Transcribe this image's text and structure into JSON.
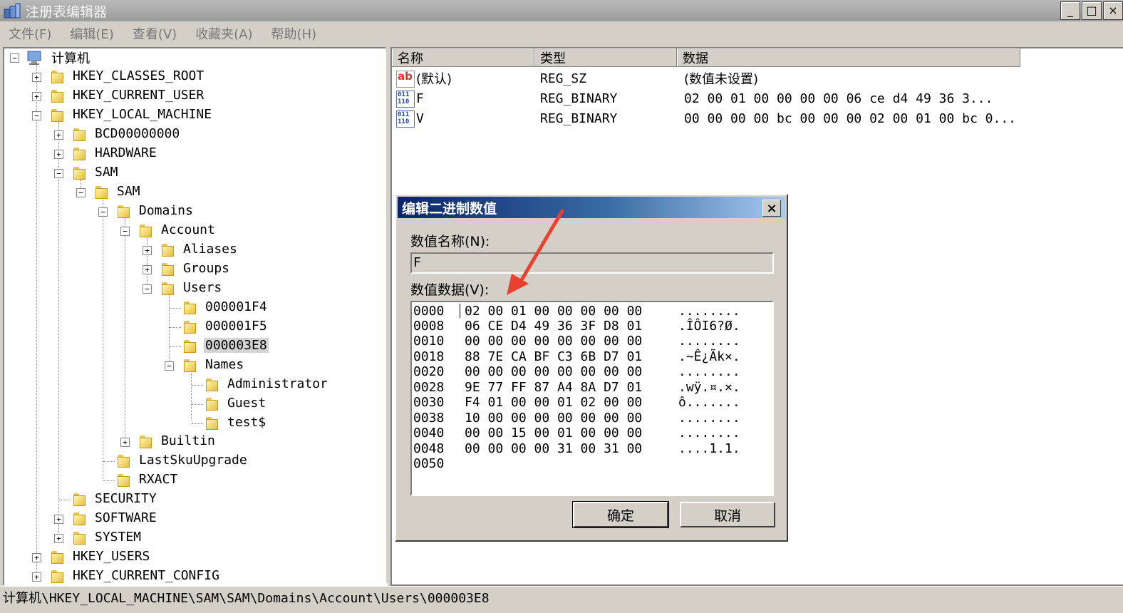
{
  "window": {
    "title": "注册表编辑器",
    "buttons": {
      "minimize": "_",
      "maximize": "□",
      "close": "×"
    }
  },
  "menu": [
    "文件(F)",
    "编辑(E)",
    "查看(V)",
    "收藏夹(A)",
    "帮助(H)"
  ],
  "tree": {
    "root": "计算机",
    "items": [
      "HKEY_CLASSES_ROOT",
      "HKEY_CURRENT_USER",
      "HKEY_LOCAL_MACHINE",
      "BCD00000000",
      "HARDWARE",
      "SAM",
      "SAM",
      "Domains",
      "Account",
      "Aliases",
      "Groups",
      "Users",
      "000001F4",
      "000001F5",
      "000003E8",
      "Names",
      "Administrator",
      "Guest",
      "test$",
      "Builtin",
      "LastSkuUpgrade",
      "RXACT",
      "SECURITY",
      "SOFTWARE",
      "SYSTEM",
      "HKEY_USERS",
      "HKEY_CURRENT_CONFIG"
    ]
  },
  "list": {
    "columns": [
      "名称",
      "类型",
      "数据"
    ],
    "rows": [
      {
        "icon": "string-value-icon",
        "icon_text": "ab",
        "name": "(默认)",
        "type": "REG_SZ",
        "data": "(数值未设置)"
      },
      {
        "icon": "binary-value-icon",
        "icon_text": "011 110",
        "name": "F",
        "type": "REG_BINARY",
        "data": "02 00 01 00 00 00 00 06 ce d4 49 36 3..."
      },
      {
        "icon": "binary-value-icon",
        "icon_text": "011 110",
        "name": "V",
        "type": "REG_BINARY",
        "data": "00 00 00 00 bc 00 00 00 02 00 01 00 bc 0..."
      }
    ]
  },
  "statusbar": {
    "path": "计算机\\HKEY_LOCAL_MACHINE\\SAM\\SAM\\Domains\\Account\\Users\\000003E8"
  },
  "dialog": {
    "title": "编辑二进制数值",
    "close": "×",
    "name_label": "数值名称(N):",
    "name_value": "F",
    "data_label": "数值数据(V):",
    "hex_rows": [
      {
        "offset": "0000",
        "hex": "02 00 01 00 00 00 00 00",
        "ascii": "........"
      },
      {
        "offset": "0008",
        "hex": "06 CE D4 49 36 3F D8 01",
        "ascii": ".ÎÔI6?Ø."
      },
      {
        "offset": "0010",
        "hex": "00 00 00 00 00 00 00 00",
        "ascii": "........"
      },
      {
        "offset": "0018",
        "hex": "88 7E CA BF C3 6B D7 01",
        "ascii": ".~Ê¿Ãk×."
      },
      {
        "offset": "0020",
        "hex": "00 00 00 00 00 00 00 00",
        "ascii": "........"
      },
      {
        "offset": "0028",
        "hex": "9E 77 FF 87 A4 8A D7 01",
        "ascii": ".wÿ.¤.×."
      },
      {
        "offset": "0030",
        "hex": "F4 01 00 00 01 02 00 00",
        "ascii": "ô......."
      },
      {
        "offset": "0038",
        "hex": "10 00 00 00 00 00 00 00",
        "ascii": "........"
      },
      {
        "offset": "0040",
        "hex": "00 00 15 00 01 00 00 00",
        "ascii": "........"
      },
      {
        "offset": "0048",
        "hex": "00 00 00 00 31 00 31 00",
        "ascii": "....1.1."
      },
      {
        "offset": "0050",
        "hex": "",
        "ascii": ""
      }
    ],
    "ok_label": "确定",
    "cancel_label": "取消"
  },
  "colors": {
    "accent_title": "#0a246a",
    "annotation_arrow": "#e8412f"
  }
}
